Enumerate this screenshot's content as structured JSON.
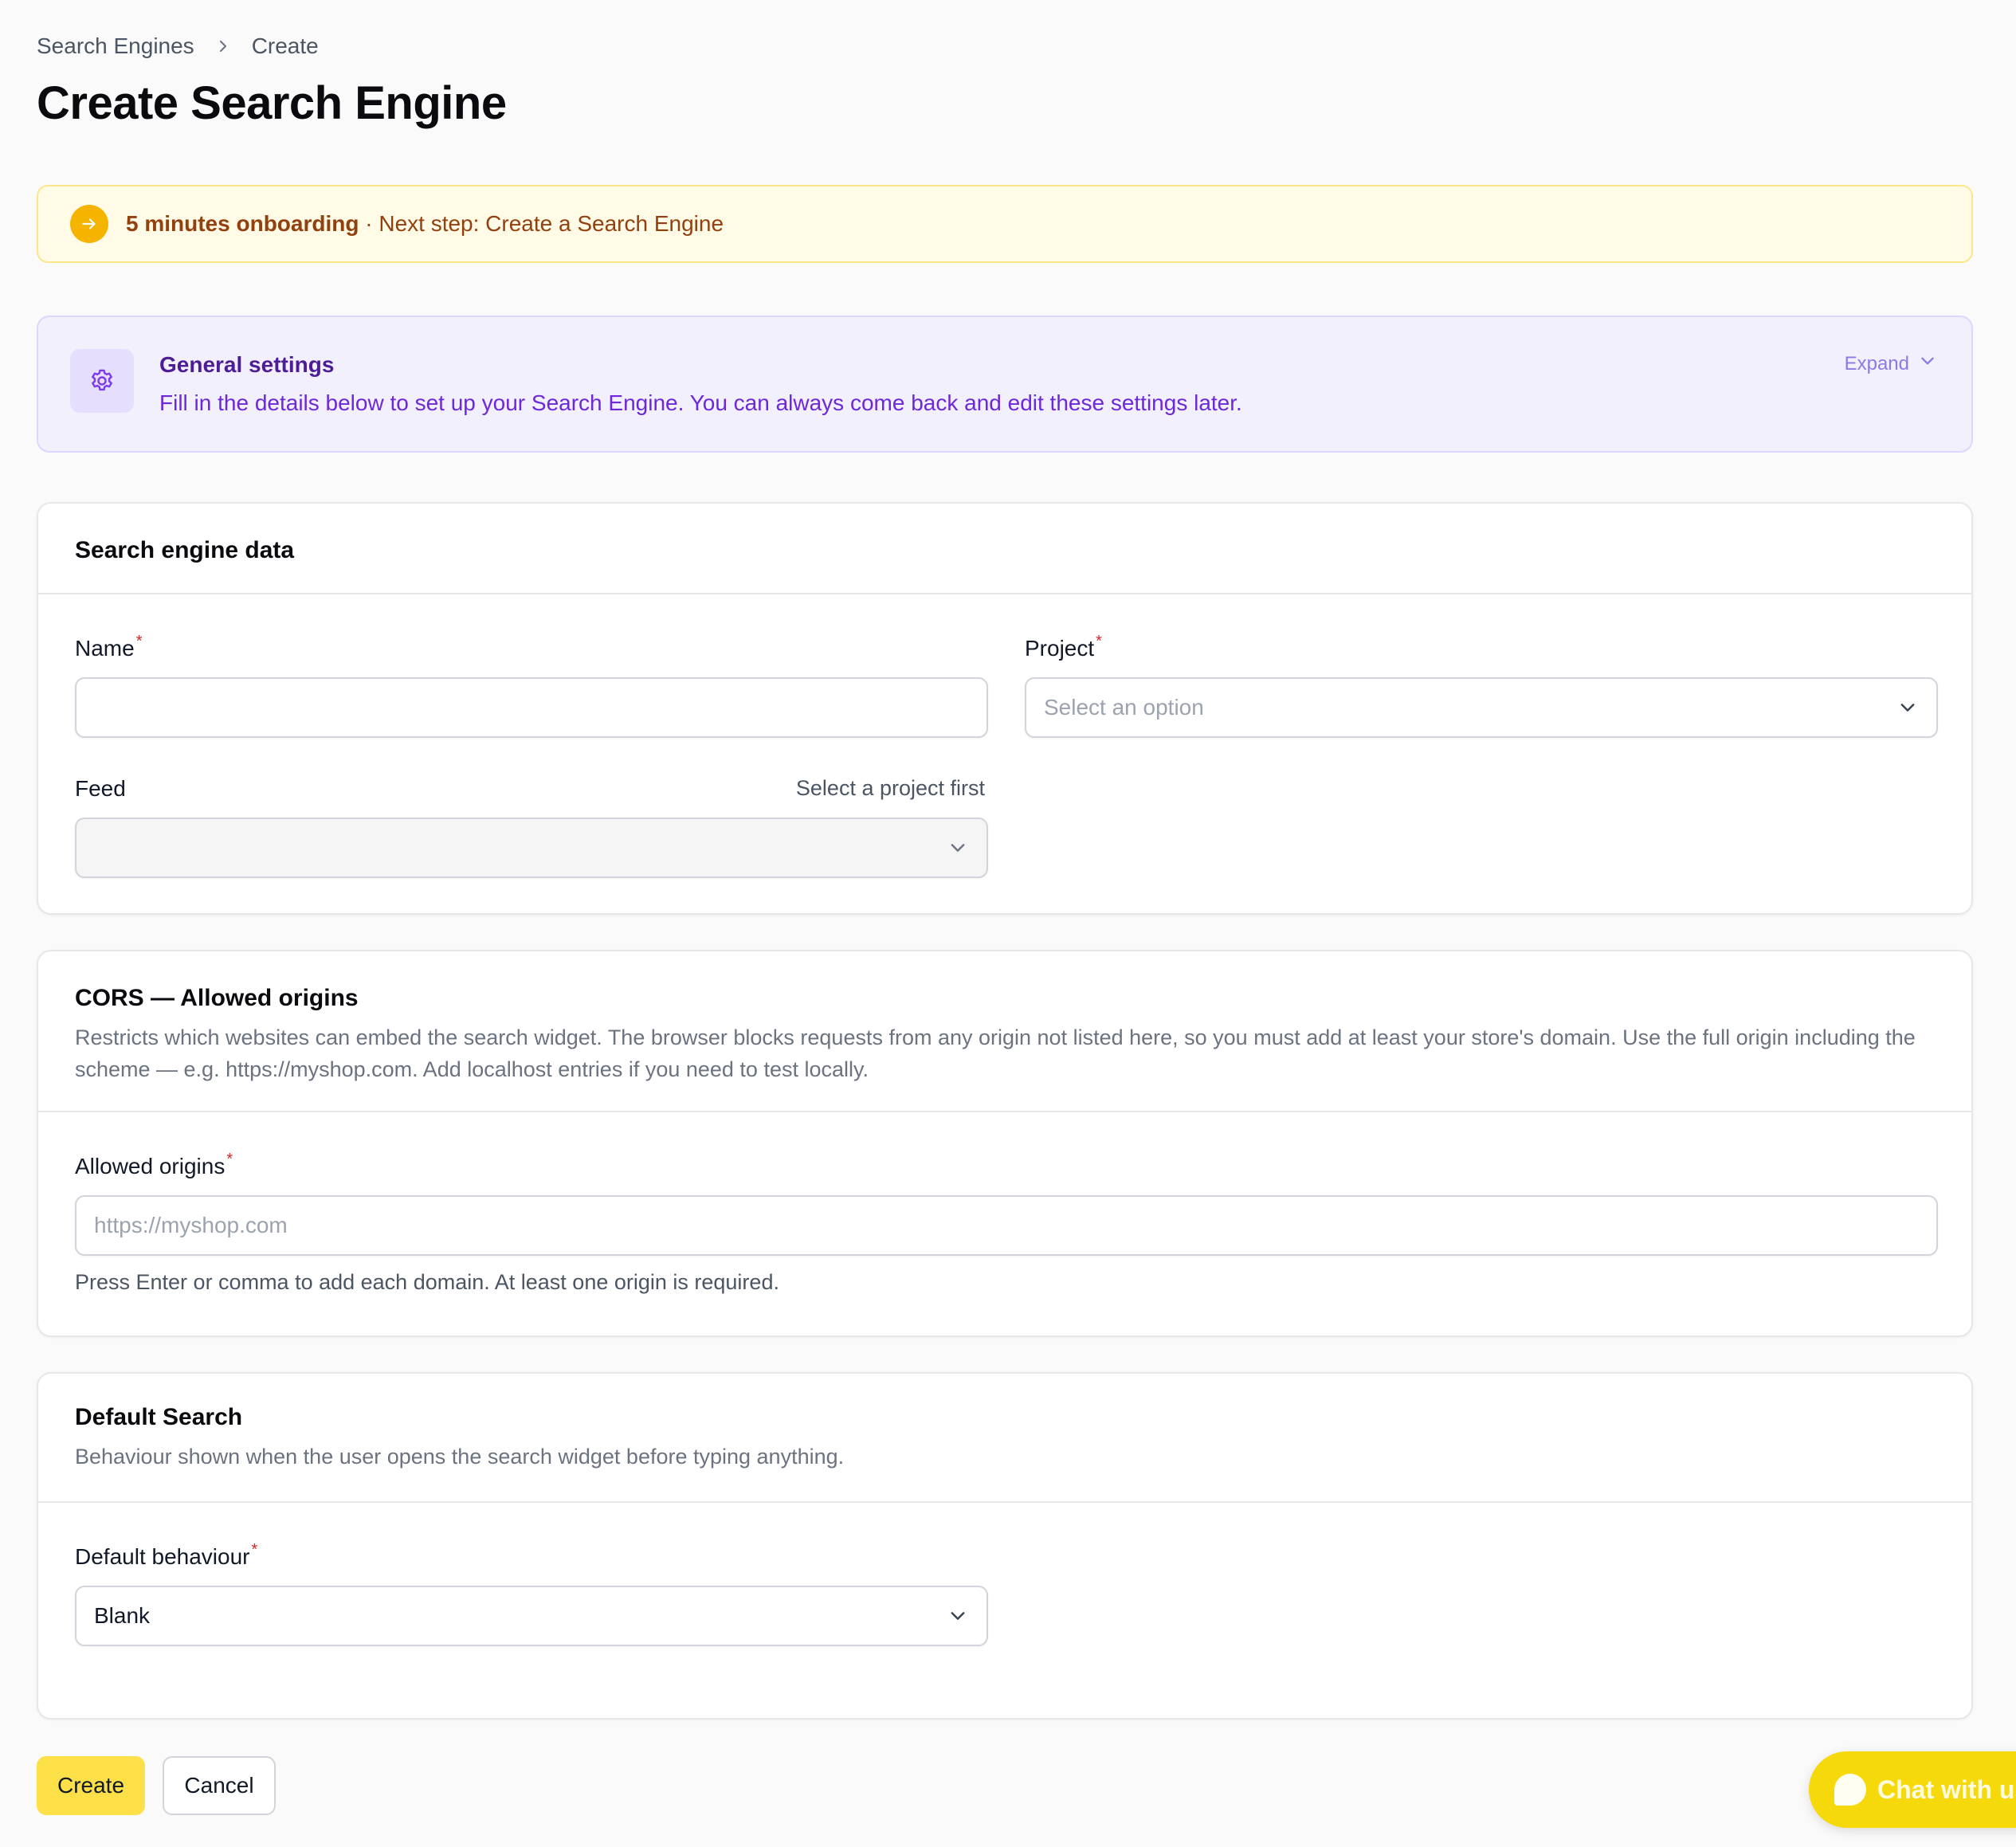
{
  "breadcrumb": {
    "parent": "Search Engines",
    "current": "Create"
  },
  "page_title": "Create Search Engine",
  "onboarding": {
    "bold": "5 minutes onboarding",
    "text": " · Next step: Create a Search Engine"
  },
  "general": {
    "title": "General settings",
    "description": "Fill in the details below to set up your Search Engine. You can always come back and edit these settings later.",
    "expand_label": "Expand"
  },
  "search_engine_data": {
    "title": "Search engine data",
    "name_label": "Name",
    "name_value": "",
    "project_label": "Project",
    "project_placeholder": "Select an option",
    "feed_label": "Feed",
    "feed_hint": "Select a project first",
    "feed_value": "",
    "required_mark": "*"
  },
  "cors": {
    "title": "CORS — Allowed origins",
    "description": "Restricts which websites can embed the search widget. The browser blocks requests from any origin not listed here, so you must add at least your store's domain. Use the full origin including the scheme — e.g. https://myshop.com. Add localhost entries if you need to test locally.",
    "origins_label": "Allowed origins",
    "origins_placeholder": "https://myshop.com",
    "help": "Press Enter or comma to add each domain. At least one origin is required."
  },
  "default_search": {
    "title": "Default Search",
    "description": "Behaviour shown when the user opens the search widget before typing anything.",
    "behaviour_label": "Default behaviour",
    "behaviour_value": "Blank"
  },
  "actions": {
    "create_label": "Create",
    "cancel_label": "Cancel"
  },
  "chat": {
    "label": "Chat with us"
  },
  "colors": {
    "accent_yellow": "#fde047",
    "onboarding_bg": "#fffbe6",
    "general_bg": "#f3f0fe",
    "required": "#dc2626"
  }
}
